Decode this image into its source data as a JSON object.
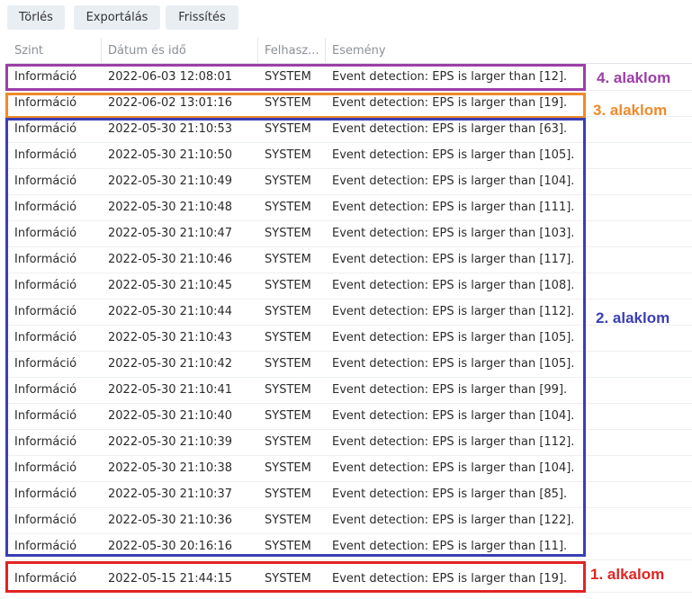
{
  "toolbar": {
    "delete_label": "Törlés",
    "export_label": "Exportálás",
    "refresh_label": "Frissítés"
  },
  "columns": {
    "level": "Szint",
    "datetime": "Dátum és idő",
    "user": "Felhasz...",
    "event": "Esemény"
  },
  "rows": [
    {
      "level": "Információ",
      "datetime": "2022-06-03 12:08:01",
      "user": "SYSTEM",
      "event": "Event detection: EPS is larger than [12]."
    },
    {
      "level": "Információ",
      "datetime": "2022-06-02 13:01:16",
      "user": "SYSTEM",
      "event": "Event detection: EPS is larger than [19]."
    },
    {
      "level": "Információ",
      "datetime": "2022-05-30 21:10:53",
      "user": "SYSTEM",
      "event": "Event detection: EPS is larger than [63]."
    },
    {
      "level": "Információ",
      "datetime": "2022-05-30 21:10:50",
      "user": "SYSTEM",
      "event": "Event detection: EPS is larger than [105]."
    },
    {
      "level": "Információ",
      "datetime": "2022-05-30 21:10:49",
      "user": "SYSTEM",
      "event": "Event detection: EPS is larger than [104]."
    },
    {
      "level": "Információ",
      "datetime": "2022-05-30 21:10:48",
      "user": "SYSTEM",
      "event": "Event detection: EPS is larger than [111]."
    },
    {
      "level": "Információ",
      "datetime": "2022-05-30 21:10:47",
      "user": "SYSTEM",
      "event": "Event detection: EPS is larger than [103]."
    },
    {
      "level": "Információ",
      "datetime": "2022-05-30 21:10:46",
      "user": "SYSTEM",
      "event": "Event detection: EPS is larger than [117]."
    },
    {
      "level": "Információ",
      "datetime": "2022-05-30 21:10:45",
      "user": "SYSTEM",
      "event": "Event detection: EPS is larger than [108]."
    },
    {
      "level": "Információ",
      "datetime": "2022-05-30 21:10:44",
      "user": "SYSTEM",
      "event": "Event detection: EPS is larger than [112]."
    },
    {
      "level": "Információ",
      "datetime": "2022-05-30 21:10:43",
      "user": "SYSTEM",
      "event": "Event detection: EPS is larger than [105]."
    },
    {
      "level": "Információ",
      "datetime": "2022-05-30 21:10:42",
      "user": "SYSTEM",
      "event": "Event detection: EPS is larger than [105]."
    },
    {
      "level": "Információ",
      "datetime": "2022-05-30 21:10:41",
      "user": "SYSTEM",
      "event": "Event detection: EPS is larger than [99]."
    },
    {
      "level": "Információ",
      "datetime": "2022-05-30 21:10:40",
      "user": "SYSTEM",
      "event": "Event detection: EPS is larger than [104]."
    },
    {
      "level": "Információ",
      "datetime": "2022-05-30 21:10:39",
      "user": "SYSTEM",
      "event": "Event detection: EPS is larger than [112]."
    },
    {
      "level": "Információ",
      "datetime": "2022-05-30 21:10:38",
      "user": "SYSTEM",
      "event": "Event detection: EPS is larger than [104]."
    },
    {
      "level": "Információ",
      "datetime": "2022-05-30 21:10:37",
      "user": "SYSTEM",
      "event": "Event detection: EPS is larger than [85]."
    },
    {
      "level": "Információ",
      "datetime": "2022-05-30 21:10:36",
      "user": "SYSTEM",
      "event": "Event detection: EPS is larger than [122]."
    },
    {
      "level": "Információ",
      "datetime": "2022-05-30 20:16:16",
      "user": "SYSTEM",
      "event": "Event detection: EPS is larger than [11]."
    },
    {
      "level": "Információ",
      "datetime": "2022-05-15 21:44:15",
      "user": "SYSTEM",
      "event": "Event detection: EPS is larger than [19]."
    }
  ],
  "annotations": {
    "occurrence_4": {
      "label": "4. alaklom",
      "color": "#9b3fa8"
    },
    "occurrence_3": {
      "label": "3. alaklom",
      "color": "#f08a2a"
    },
    "occurrence_2": {
      "label": "2. alaklom",
      "color": "#3a3fb4"
    },
    "occurrence_1": {
      "label": "1. alkalom",
      "color": "#e02424"
    }
  }
}
